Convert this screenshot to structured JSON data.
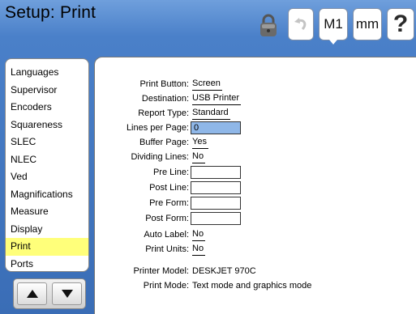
{
  "header": {
    "title": "Setup: Print",
    "buttons": {
      "m1": "M1",
      "mm": "mm",
      "help": "?"
    },
    "icons": [
      "lock-icon",
      "undo-icon"
    ]
  },
  "sidebar": {
    "items": [
      {
        "label": "Languages"
      },
      {
        "label": "Supervisor"
      },
      {
        "label": "Encoders"
      },
      {
        "label": "Squareness"
      },
      {
        "label": "SLEC"
      },
      {
        "label": "NLEC"
      },
      {
        "label": "Ved"
      },
      {
        "label": "Magnifications"
      },
      {
        "label": "Measure"
      },
      {
        "label": "Display"
      },
      {
        "label": "Print",
        "selected": true
      },
      {
        "label": "Ports"
      }
    ],
    "active_color": "#ffff7a"
  },
  "form": {
    "print_button": {
      "label": "Print Button:",
      "value": "Screen"
    },
    "destination": {
      "label": "Destination:",
      "value": "USB Printer"
    },
    "report_type": {
      "label": "Report Type:",
      "value": "Standard"
    },
    "lines_per_page": {
      "label": "Lines per Page:",
      "value": "0"
    },
    "buffer_page": {
      "label": "Buffer Page:",
      "value": "Yes"
    },
    "dividing_lines": {
      "label": "Dividing Lines:",
      "value": "No"
    },
    "pre_line": {
      "label": "Pre Line:",
      "value": ""
    },
    "post_line": {
      "label": "Post Line:",
      "value": ""
    },
    "pre_form": {
      "label": "Pre Form:",
      "value": ""
    },
    "post_form": {
      "label": "Post Form:",
      "value": ""
    },
    "auto_label": {
      "label": "Auto Label:",
      "value": "No"
    },
    "print_units": {
      "label": "Print Units:",
      "value": "No"
    },
    "printer_model": {
      "label": "Printer Model:",
      "value": "DESKJET 970C"
    },
    "print_mode": {
      "label": "Print Mode:",
      "value": "Text mode and graphics mode"
    }
  }
}
